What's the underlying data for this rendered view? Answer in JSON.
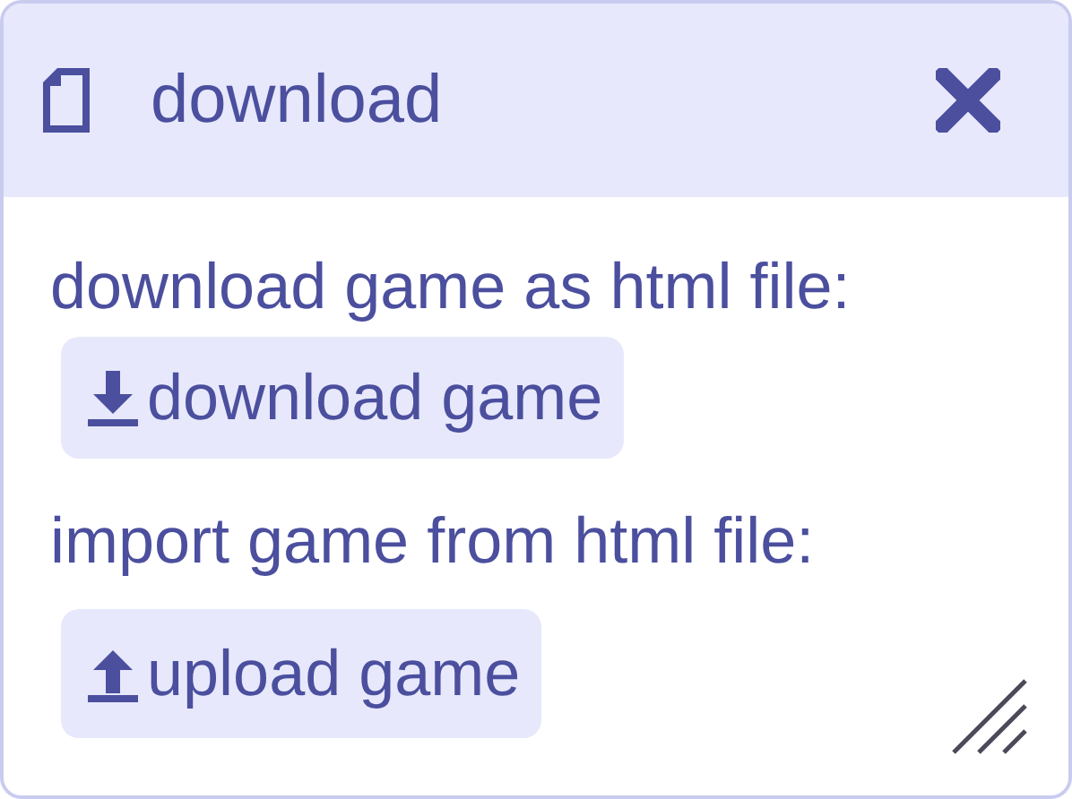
{
  "window": {
    "title": "download"
  },
  "sections": [
    {
      "label": "download game as html file:",
      "button": "download game",
      "kind": "download"
    },
    {
      "label": "import game from html file:",
      "button": "upload game",
      "kind": "upload"
    }
  ]
}
